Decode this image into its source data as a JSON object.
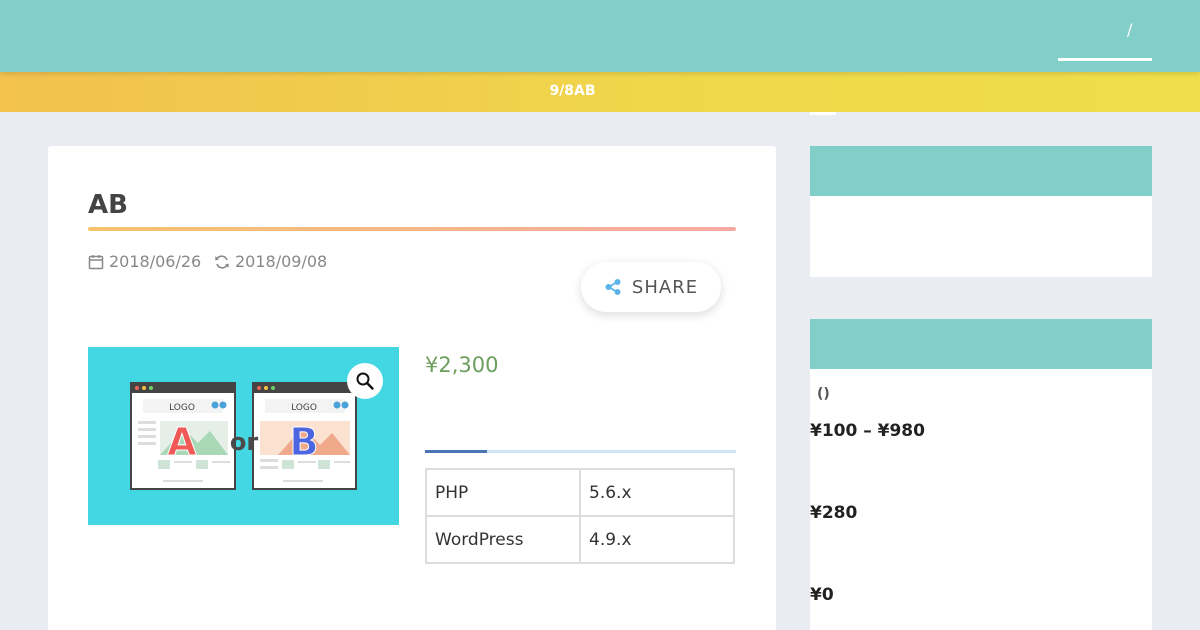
{
  "header": {
    "nav_separator": "/"
  },
  "notice": {
    "text": "9/8AB"
  },
  "article": {
    "title": "AB",
    "published": "2018/06/26",
    "updated": "2018/09/08",
    "share_label": "SHARE",
    "price": "¥2,300",
    "image": {
      "logo_text": "LOGO",
      "letter_a": "A",
      "letter_or": "or",
      "letter_b": "B"
    },
    "specs": [
      {
        "key": "PHP",
        "value": "5.6.x"
      },
      {
        "key": "WordPress",
        "value": "4.9.x"
      }
    ]
  },
  "sidebar": {
    "filter_note": "()",
    "prices": [
      "¥100 – ¥980",
      "¥280",
      "¥0"
    ]
  },
  "colors": {
    "header": "#82cfca",
    "notice": "#efd84a",
    "price": "#6c9e5e",
    "tab_active": "#4a76b8"
  }
}
